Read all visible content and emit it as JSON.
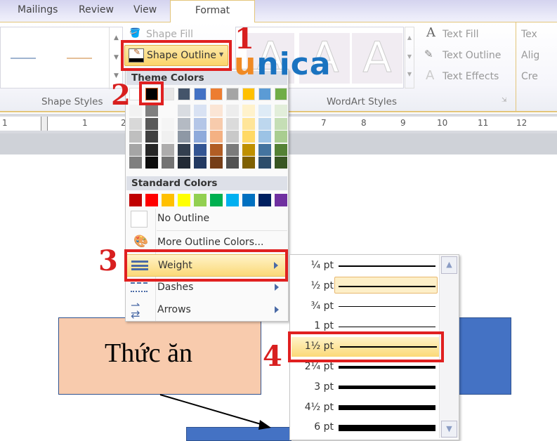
{
  "tabs": [
    "Mailings",
    "Review",
    "View",
    "Format"
  ],
  "ribbon": {
    "shape_fill": "Shape Fill",
    "shape_outline": "Shape Outline",
    "shape_styles": "Shape Styles",
    "text_fill": "Text Fill",
    "text_outline": "Text Outline",
    "text_effects": "Text Effects",
    "wordart_styles": "WordArt Styles",
    "text_direction": "Tex",
    "align": "Alig",
    "create_link": "Cre"
  },
  "ruler": [
    "1",
    "1",
    "2",
    "7",
    "8",
    "9",
    "10",
    "11",
    "12"
  ],
  "logo": "unica",
  "menu": {
    "theme_colors_label": "Theme Colors",
    "theme_colors": [
      "#ffffff",
      "#000000",
      "#e7e6e6",
      "#44546a",
      "#4472c4",
      "#ed7d31",
      "#a5a5a5",
      "#ffc000",
      "#5b9bd5",
      "#70ad47"
    ],
    "selected_color": "#000000",
    "standard_colors_label": "Standard Colors",
    "standard_colors": [
      "#c00000",
      "#ff0000",
      "#ffc000",
      "#ffff00",
      "#92d050",
      "#00b050",
      "#00b0f0",
      "#0070c0",
      "#002060",
      "#7030a0"
    ],
    "no_outline": "No Outline",
    "more_colors": "More Outline Colors...",
    "weight": "Weight",
    "dashes": "Dashes",
    "arrows": "Arrows"
  },
  "weight_menu": {
    "items": [
      {
        "label": "¼ pt",
        "pt": 0.25
      },
      {
        "label": "½ pt",
        "pt": 0.5
      },
      {
        "label": "¾ pt",
        "pt": 0.75
      },
      {
        "label": "1 pt",
        "pt": 1
      },
      {
        "label": "1½ pt",
        "pt": 1.5
      },
      {
        "label": "2¼ pt",
        "pt": 2.25
      },
      {
        "label": "3 pt",
        "pt": 3
      },
      {
        "label": "4½ pt",
        "pt": 4.5
      },
      {
        "label": "6 pt",
        "pt": 6
      }
    ],
    "hovered": "½ pt",
    "selected": "1½ pt"
  },
  "document": {
    "shape_text": "Thức ăn"
  },
  "steps": [
    "1",
    "2",
    "3",
    "4"
  ],
  "highlight_color": "#e02020"
}
